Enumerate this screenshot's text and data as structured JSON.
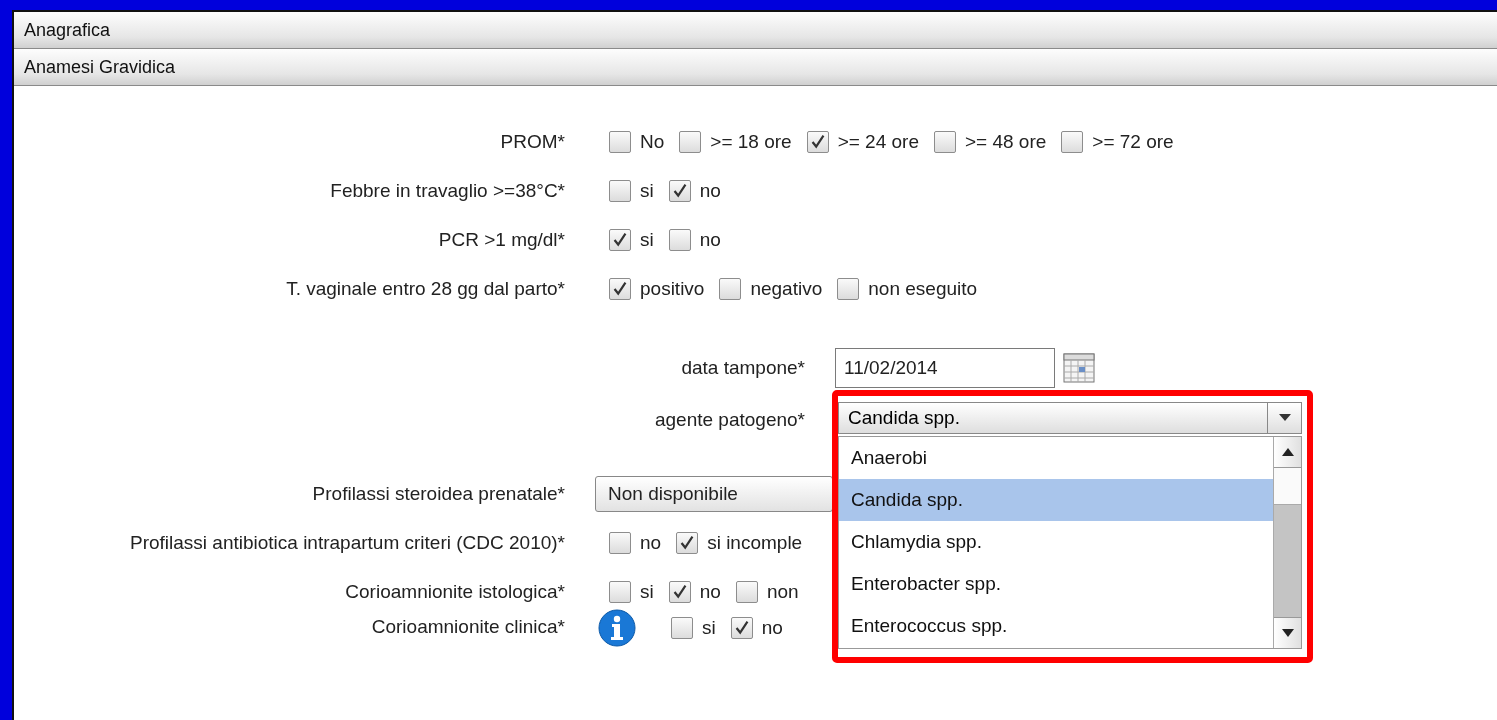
{
  "sections": [
    {
      "title": "Anagrafica"
    },
    {
      "title": "Anamesi Gravidica"
    }
  ],
  "fields": [
    {
      "kind": "checks",
      "label": "PROM*",
      "options": [
        {
          "label": "No",
          "checked": false
        },
        {
          "label": ">= 18 ore",
          "checked": false
        },
        {
          "label": ">= 24 ore",
          "checked": true
        },
        {
          "label": ">= 48 ore",
          "checked": false
        },
        {
          "label": ">= 72 ore",
          "checked": false
        }
      ]
    },
    {
      "kind": "checks",
      "label": "Febbre in travaglio >=38°C*",
      "options": [
        {
          "label": "si",
          "checked": false
        },
        {
          "label": "no",
          "checked": true
        }
      ]
    },
    {
      "kind": "checks",
      "label": "PCR >1 mg/dl*",
      "options": [
        {
          "label": "si",
          "checked": true
        },
        {
          "label": "no",
          "checked": false
        }
      ]
    },
    {
      "kind": "checks",
      "label": "T. vaginale entro 28 gg dal parto*",
      "options": [
        {
          "label": "positivo",
          "checked": true
        },
        {
          "label": "negativo",
          "checked": false
        },
        {
          "label": "non eseguito",
          "checked": false
        }
      ]
    },
    {
      "kind": "date",
      "label": "data tampone*",
      "value": "11/02/2014"
    },
    {
      "kind": "combo",
      "label": "agente patogeno*",
      "value": "Candida spp.",
      "expanded": true,
      "options": [
        {
          "label": "Anaerobi",
          "selected": false
        },
        {
          "label": "Candida spp.",
          "selected": true
        },
        {
          "label": "Chlamydia spp.",
          "selected": false
        },
        {
          "label": "Enterobacter spp.",
          "selected": false
        },
        {
          "label": "Enterococcus spp.",
          "selected": false
        }
      ]
    },
    {
      "kind": "select",
      "label": "Profilassi steroidea prenatale*",
      "value": "Non disponibile"
    },
    {
      "kind": "checks",
      "label": "Profilassi antibiotica intrapartum criteri (CDC 2010)*",
      "options": [
        {
          "label": "no",
          "checked": false
        },
        {
          "label": "si incomple",
          "checked": true
        }
      ]
    },
    {
      "kind": "checks",
      "label": "Corioamnionite istologica*",
      "options": [
        {
          "label": "si",
          "checked": false
        },
        {
          "label": "no",
          "checked": true
        },
        {
          "label": "non",
          "checked": false
        }
      ]
    },
    {
      "kind": "checks",
      "label": "Corioamnionite clinica*",
      "info": true,
      "options": [
        {
          "label": "si",
          "checked": false
        },
        {
          "label": "no",
          "checked": true
        }
      ]
    }
  ]
}
